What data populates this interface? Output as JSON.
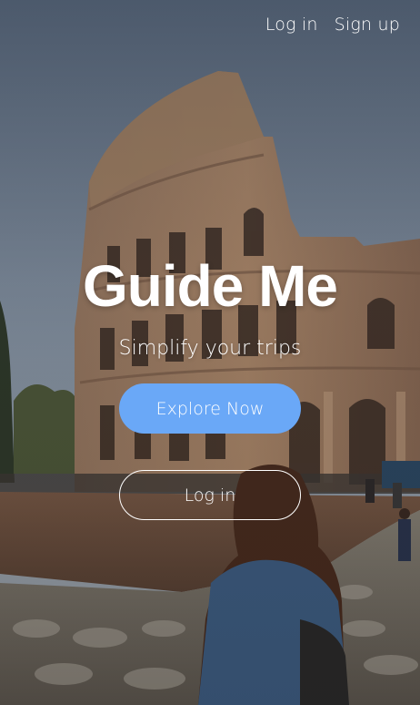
{
  "nav": {
    "login_label": "Log in",
    "signup_label": "Sign up"
  },
  "hero": {
    "title": "Guide Me",
    "subtitle": "Simplify your trips",
    "explore_label": "Explore Now",
    "login_label": "Log in"
  },
  "colors": {
    "primary_button": "#6aa8f7",
    "text": "#ffffff"
  }
}
